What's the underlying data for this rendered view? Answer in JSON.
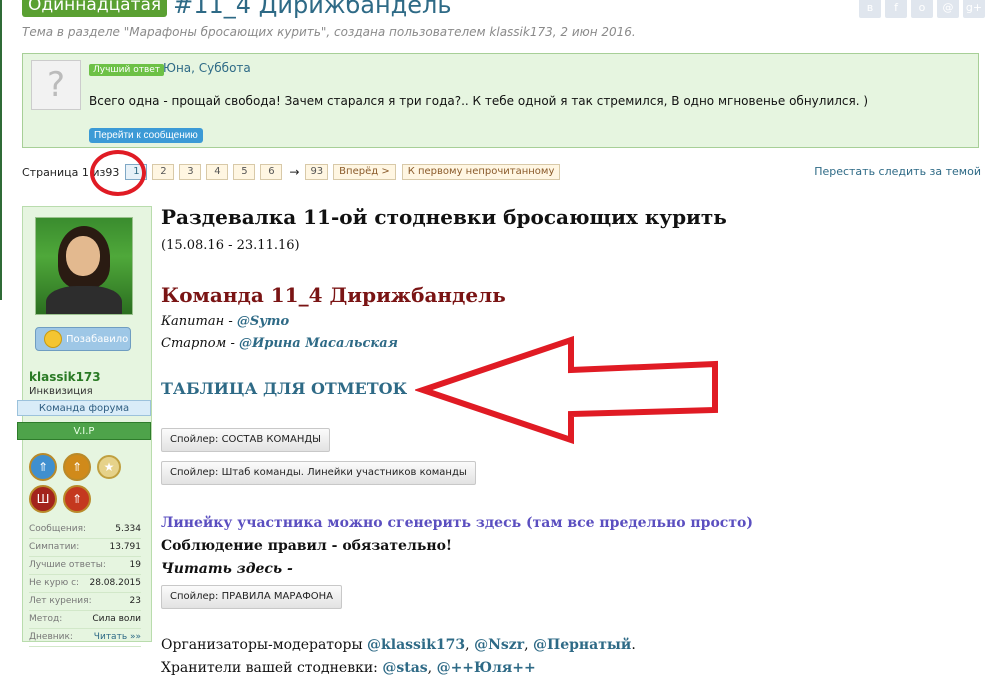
{
  "header": {
    "prefix": "Одиннадцатая",
    "title": "#11_4 Дирижбандель",
    "subtitle": "Тема в разделе \"Марафоны бросающих курить\", создана пользователем klassik173, 2 июн 2016."
  },
  "share_icons": [
    "vk-icon",
    "facebook-icon",
    "odnoklassniki-icon",
    "mailru-icon",
    "googleplus-icon"
  ],
  "best_answer": {
    "badge": "Лучший ответ",
    "users": "Юна, Суббота",
    "text": "Всего одна - прощай свобода! Зачем старался я три года?.. К тебе одной я так стремился, В одно мгновенье обнулился. )",
    "button": "Перейти к сообщению"
  },
  "pager": {
    "label": "Страница 1 из 93",
    "label_prefix": "Страница 1 из",
    "label_total": "93",
    "pages": [
      "1",
      "2",
      "3",
      "4",
      "5",
      "6"
    ],
    "current": "1",
    "arrow": "→",
    "last": "93",
    "next": "Вперёд >",
    "first_unread": "К первому непрочитанному",
    "unwatch": "Перестать следить за темой"
  },
  "user": {
    "liked_label": "Позабавило",
    "name": "klassik173",
    "title": "Инквизиция",
    "team_badge": "Команда форума",
    "vip_badge": "V.I.P",
    "stats": [
      {
        "k": "Сообщения:",
        "v": "5.334"
      },
      {
        "k": "Симпатии:",
        "v": "13.791"
      },
      {
        "k": "Лучшие ответы:",
        "v": "19"
      },
      {
        "k": "Не курю с:",
        "v": "28.08.2015"
      },
      {
        "k": "Лет курения:",
        "v": "23"
      },
      {
        "k": "Метод:",
        "v": "Сила воли"
      },
      {
        "k": "Дневник:",
        "v": "Читать »»"
      }
    ]
  },
  "post": {
    "heading": "Раздевалка 11-ой стодневки бросающих курить",
    "dates": "(15.08.16 - 23.11.16)",
    "team_title": "Команда 11_4 Дирижбандель",
    "captain_label": "Капитан - ",
    "captain": "@Symo",
    "mate_label": "Старпом - ",
    "mate": "@Ирина Масальская",
    "table_link": "ТАБЛИЦА ДЛЯ ОТМЕТОК",
    "spoiler1": "Спойлер: СОСТАВ КОМАНДЫ",
    "spoiler2": "Спойлер: Штаб команды. Линейки участников команды",
    "gen_line": "Линейку участника можно сгенерить здесь (там все предельно просто)",
    "rules": "Соблюдение правил - обязательно!",
    "read": "Читать здесь -",
    "spoiler3": "Спойлер: ПРАВИЛА МАРАФОНА",
    "org_label": "Организаторы-модераторы ",
    "org1": "@klassik173",
    "org2": "@Nszr",
    "org3": "@Пернатый",
    "keep_label": "Хранители вашей стодневки: ",
    "keep1": "@stas",
    "keep2": "@++Юля++"
  },
  "colors": {
    "prefix_bg": "#5aa032",
    "link": "#2e6a86",
    "annotation_red": "#e01b24",
    "sidebar_bg": "#e6f5e0"
  }
}
